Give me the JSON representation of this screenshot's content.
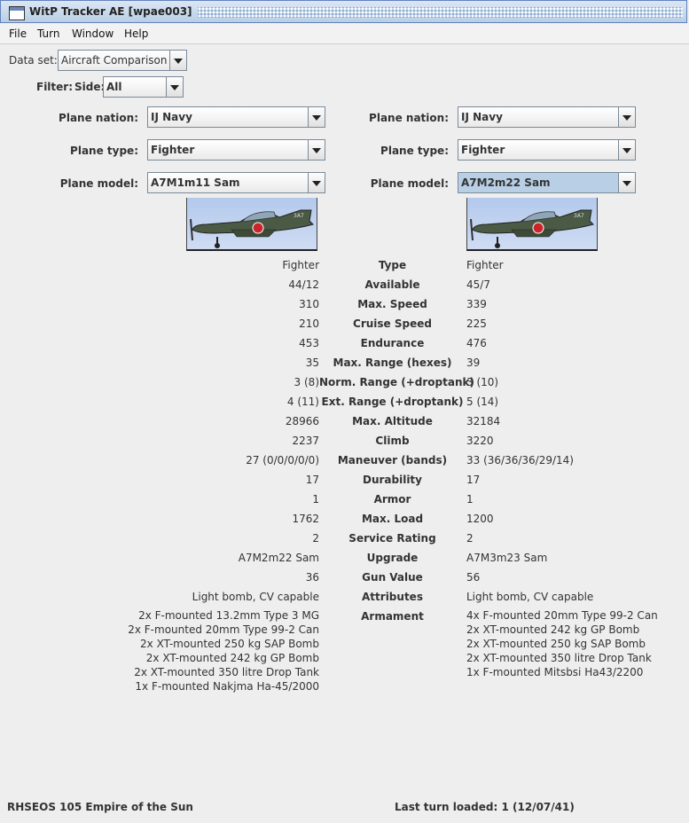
{
  "window": {
    "title": "WitP Tracker AE [wpae003]"
  },
  "menu": [
    "File",
    "Turn",
    "Window",
    "Help"
  ],
  "dataset": {
    "label": "Data set:",
    "value": "Aircraft Comparison"
  },
  "filter": {
    "label": "Filter:",
    "side_label": "Side:",
    "side_value": "All"
  },
  "left": {
    "nation_label": "Plane nation:",
    "nation": "IJ Navy",
    "type_label": "Plane type:",
    "type": "Fighter",
    "model_label": "Plane model:",
    "model": "A7M1m11 Sam"
  },
  "right": {
    "nation_label": "Plane nation:",
    "nation": "IJ Navy",
    "type_label": "Plane type:",
    "type": "Fighter",
    "model_label": "Plane model:",
    "model": "A7M2m22 Sam"
  },
  "plane_marking": "3A7",
  "stats": [
    {
      "label": "Type",
      "left": "Fighter",
      "right": "Fighter"
    },
    {
      "label": "Available",
      "left": "44/12",
      "right": "45/7"
    },
    {
      "label": "Max. Speed",
      "left": "310",
      "right": "339"
    },
    {
      "label": "Cruise Speed",
      "left": "210",
      "right": "225"
    },
    {
      "label": "Endurance",
      "left": "453",
      "right": "476"
    },
    {
      "label": "Max. Range (hexes)",
      "left": "35",
      "right": "39"
    },
    {
      "label": "Norm. Range (+droptank)",
      "left": "3 (8)",
      "right": "3 (10)"
    },
    {
      "label": "Ext. Range (+droptank)",
      "left": "4 (11)",
      "right": "5 (14)"
    },
    {
      "label": "Max. Altitude",
      "left": "28966",
      "right": "32184"
    },
    {
      "label": "Climb",
      "left": "2237",
      "right": "3220"
    },
    {
      "label": "Maneuver (bands)",
      "left": "27 (0/0/0/0/0)",
      "right": "33 (36/36/36/29/14)"
    },
    {
      "label": "Durability",
      "left": "17",
      "right": "17"
    },
    {
      "label": "Armor",
      "left": "1",
      "right": "1"
    },
    {
      "label": "Max. Load",
      "left": "1762",
      "right": "1200"
    },
    {
      "label": "Service Rating",
      "left": "2",
      "right": "2"
    },
    {
      "label": "Upgrade",
      "left": "A7M2m22 Sam",
      "right": "A7M3m23 Sam"
    },
    {
      "label": "Gun Value",
      "left": "36",
      "right": "56"
    },
    {
      "label": "Attributes",
      "left": "Light bomb, CV capable",
      "right": "Light bomb, CV capable"
    }
  ],
  "armament": {
    "label": "Armament",
    "left": [
      "2x F-mounted 13.2mm Type 3 MG",
      "2x F-mounted 20mm Type 99-2 Can",
      "2x XT-mounted 250 kg SAP Bomb",
      "2x XT-mounted 242 kg GP Bomb",
      "2x XT-mounted 350 litre Drop Tank",
      "1x F-mounted Nakjma Ha-45/2000"
    ],
    "right": [
      "4x F-mounted 20mm Type 99-2 Can",
      "2x XT-mounted 242 kg GP Bomb",
      "2x XT-mounted 250 kg SAP Bomb",
      "2x XT-mounted 350 litre Drop Tank",
      "1x F-mounted Mitsbsi Ha43/2200"
    ]
  },
  "status": {
    "scenario": "RHSEOS 105 Empire of the Sun",
    "last_turn": "Last turn loaded: 1 (12/07/41)"
  }
}
